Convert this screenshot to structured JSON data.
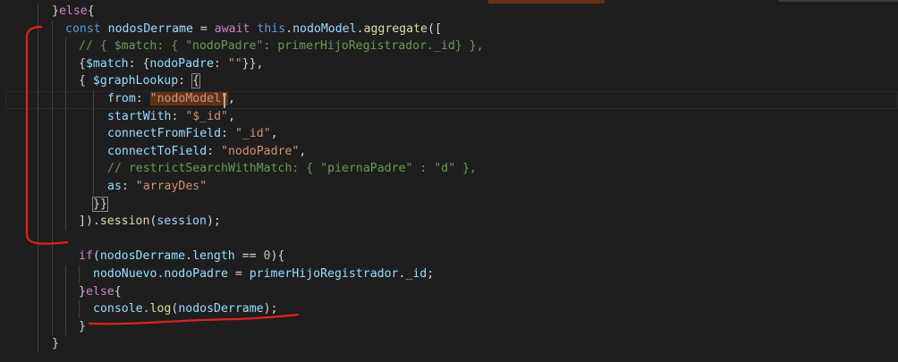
{
  "colors": {
    "background": "#1e1e1e",
    "keyword": "#569cd6",
    "control": "#c586c0",
    "variable": "#9cdcfe",
    "function": "#dcdcaa",
    "string": "#ce9178",
    "number": "#b5cea8",
    "comment": "#6a9955",
    "plain": "#d4d4d4",
    "annotation": "#e51e1e"
  },
  "lines": [
    [
      [
        "}",
        "plain"
      ],
      [
        "else",
        "control"
      ],
      [
        "{",
        "plain"
      ]
    ],
    [
      [
        "const ",
        "keyword"
      ],
      [
        "nodosDerrame",
        "variable"
      ],
      [
        " = ",
        "plain"
      ],
      [
        "await ",
        "control"
      ],
      [
        "this",
        "keyword"
      ],
      [
        ".",
        "plain"
      ],
      [
        "nodoModel",
        "variable"
      ],
      [
        ".",
        "plain"
      ],
      [
        "aggregate",
        "function"
      ],
      [
        "([",
        "plain"
      ]
    ],
    [
      [
        "// { $match: { \"nodoPadre\": primerHijoRegistrador._id} },",
        "comment"
      ]
    ],
    [
      [
        "{",
        "plain"
      ],
      [
        "$match",
        "variable"
      ],
      [
        ": {",
        "plain"
      ],
      [
        "nodoPadre",
        "variable"
      ],
      [
        ": ",
        "plain"
      ],
      [
        "\"\"",
        "string"
      ],
      [
        "}},",
        "plain"
      ]
    ],
    [
      [
        "{ ",
        "plain"
      ],
      [
        "$graphLookup",
        "variable"
      ],
      [
        ": ",
        "plain"
      ],
      [
        "{",
        "plain"
      ]
    ],
    [
      [
        "from",
        "variable"
      ],
      [
        ": ",
        "plain"
      ],
      [
        "\"nodoModel\"",
        "string"
      ],
      [
        ",",
        "plain"
      ]
    ],
    [
      [
        "startWith",
        "variable"
      ],
      [
        ": ",
        "plain"
      ],
      [
        "\"$_id\"",
        "string"
      ],
      [
        ",",
        "plain"
      ]
    ],
    [
      [
        "connectFromField",
        "variable"
      ],
      [
        ": ",
        "plain"
      ],
      [
        "\"_id\"",
        "string"
      ],
      [
        ",",
        "plain"
      ]
    ],
    [
      [
        "connectToField",
        "variable"
      ],
      [
        ": ",
        "plain"
      ],
      [
        "\"nodoPadre\"",
        "string"
      ],
      [
        ",",
        "plain"
      ]
    ],
    [
      [
        "// restrictSearchWithMatch: { \"piernaPadre\" : \"d\" },",
        "comment"
      ]
    ],
    [
      [
        "as",
        "variable"
      ],
      [
        ": ",
        "plain"
      ],
      [
        "\"arrayDes\"",
        "string"
      ]
    ],
    [
      [
        "}}",
        "plain"
      ]
    ],
    [
      [
        "]).",
        "plain"
      ],
      [
        "session",
        "function"
      ],
      [
        "(",
        "plain"
      ],
      [
        "session",
        "variable"
      ],
      [
        ");",
        "plain"
      ]
    ],
    [],
    [
      [
        "if",
        "control"
      ],
      [
        "(",
        "plain"
      ],
      [
        "nodosDerrame",
        "variable"
      ],
      [
        ".",
        "plain"
      ],
      [
        "length",
        "variable"
      ],
      [
        " == ",
        "plain"
      ],
      [
        "0",
        "number"
      ],
      [
        "){",
        "plain"
      ]
    ],
    [
      [
        "nodoNuevo",
        "variable"
      ],
      [
        ".",
        "plain"
      ],
      [
        "nodoPadre",
        "variable"
      ],
      [
        " = ",
        "plain"
      ],
      [
        "primerHijoRegistrador",
        "variable"
      ],
      [
        ".",
        "plain"
      ],
      [
        "_id",
        "variable"
      ],
      [
        ";",
        "plain"
      ]
    ],
    [
      [
        "}",
        "plain"
      ],
      [
        "else",
        "control"
      ],
      [
        "{",
        "plain"
      ]
    ],
    [
      [
        "console",
        "variable"
      ],
      [
        ".",
        "plain"
      ],
      [
        "log",
        "function"
      ],
      [
        "(",
        "plain"
      ],
      [
        "nodosDerrame",
        "variable"
      ],
      [
        ");",
        "plain"
      ]
    ],
    [
      [
        "}",
        "plain"
      ]
    ],
    [
      [
        "}",
        "plain"
      ]
    ]
  ]
}
